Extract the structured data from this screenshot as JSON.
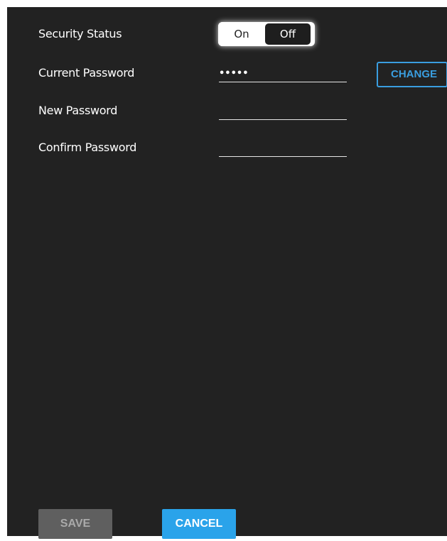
{
  "security": {
    "status_label": "Security Status",
    "toggle": {
      "on_label": "On",
      "off_label": "Off",
      "selected": "Off"
    }
  },
  "form": {
    "current_password_label": "Current Password",
    "current_password_value": "•••••",
    "new_password_label": "New Password",
    "new_password_value": "",
    "confirm_password_label": "Confirm Password",
    "confirm_password_value": "",
    "change_label": "CHANGE"
  },
  "actions": {
    "save_label": "SAVE",
    "cancel_label": "CANCEL"
  },
  "colors": {
    "background": "#222222",
    "accent": "#2aa3ea",
    "disabled": "#5f5f5f"
  }
}
